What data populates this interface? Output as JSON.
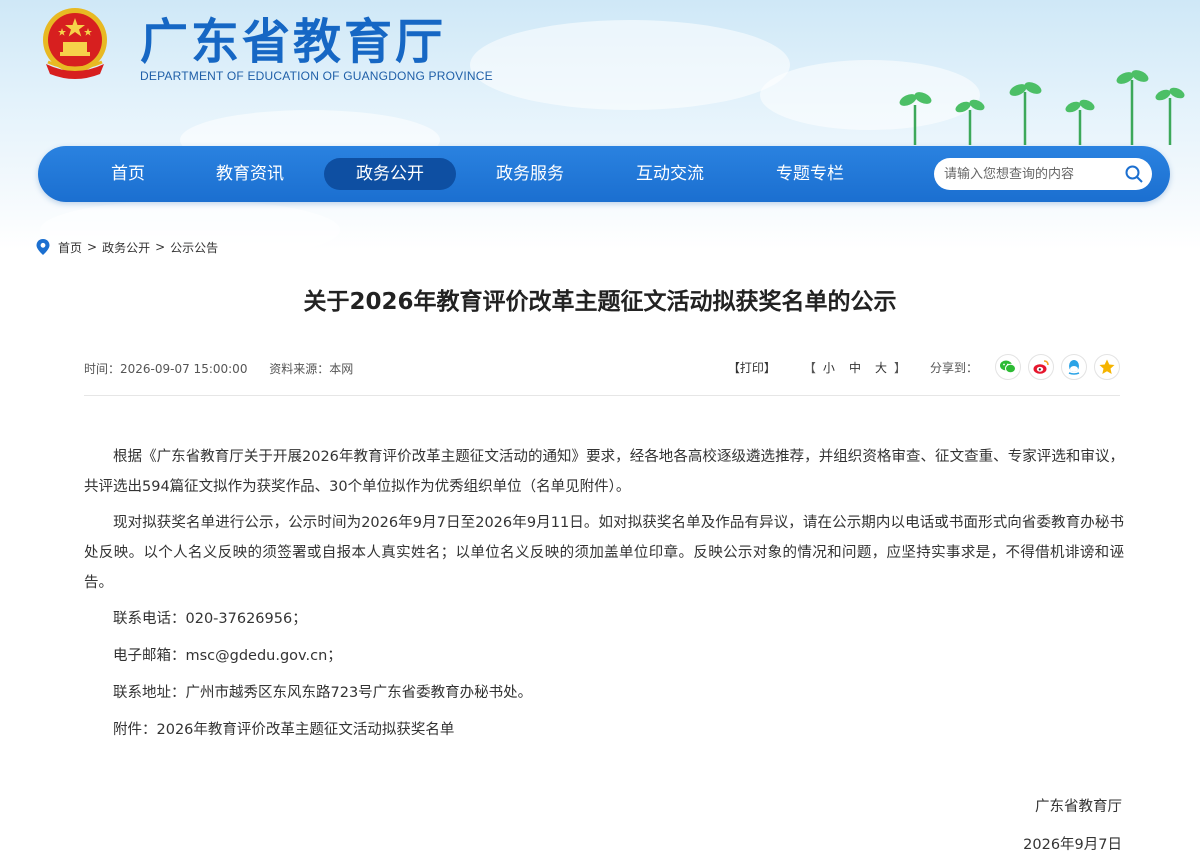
{
  "header": {
    "title": "广东省教育厅",
    "subtitle": "DEPARTMENT OF EDUCATION OF GUANGDONG PROVINCE"
  },
  "nav": {
    "items": [
      {
        "label": "首页"
      },
      {
        "label": "教育资讯"
      },
      {
        "label": "政务公开",
        "active": true
      },
      {
        "label": "政务服务"
      },
      {
        "label": "互动交流"
      },
      {
        "label": "专题专栏"
      }
    ],
    "search_placeholder": "请输入您想查询的内容"
  },
  "breadcrumb": {
    "items": [
      "首页",
      "政务公开",
      "公示公告"
    ],
    "separator": ">"
  },
  "article": {
    "title": "关于2026年教育评价改革主题征文活动拟获奖名单的公示",
    "time": "时间：2026-09-07 15:00:00",
    "source": "资料来源：本网",
    "print": "【打印】",
    "font_open": "【",
    "font_small": "小",
    "font_medium": "中",
    "font_large": "大",
    "font_close": "】",
    "share_label": "分享到：",
    "share_icons": [
      "wechat-icon",
      "weibo-icon",
      "qq-icon",
      "qzone-icon"
    ],
    "paragraphs": [
      "根据《广东省教育厅关于开展2026年教育评价改革主题征文活动的通知》要求，经各地各高校逐级遴选推荐，并组织资格审查、征文查重、专家评选和审议，共评选出594篇征文拟作为获奖作品、30个单位拟作为优秀组织单位（名单见附件）。",
      "现对拟获奖名单进行公示，公示时间为2026年9月7日至2026年9月11日。如对拟获奖名单及作品有异议，请在公示期内以电话或书面形式向省委教育办秘书处反映。以个人名义反映的须签署或自报本人真实姓名；以单位名义反映的须加盖单位印章。反映公示对象的情况和问题，应坚持实事求是，不得借机诽谤和诬告。"
    ],
    "phone": "联系电话：020-37626956；",
    "email": "电子邮箱：msc@gdedu.gov.cn；",
    "address": "联系地址：广州市越秀区东风东路723号广东省委教育办秘书处。",
    "attachment": "附件：2026年教育评价改革主题征文活动拟获奖名单",
    "signature_org": "广东省教育厅",
    "signature_date": "2026年9月7日"
  },
  "colors": {
    "brand_blue": "#1667c4",
    "nav_blue": "#1b6fd0",
    "nav_active": "#0e4fa2",
    "wechat": "#2dbb34",
    "weibo": "#e6162d",
    "qq": "#2ba3e6",
    "qzone": "#f5b400"
  }
}
